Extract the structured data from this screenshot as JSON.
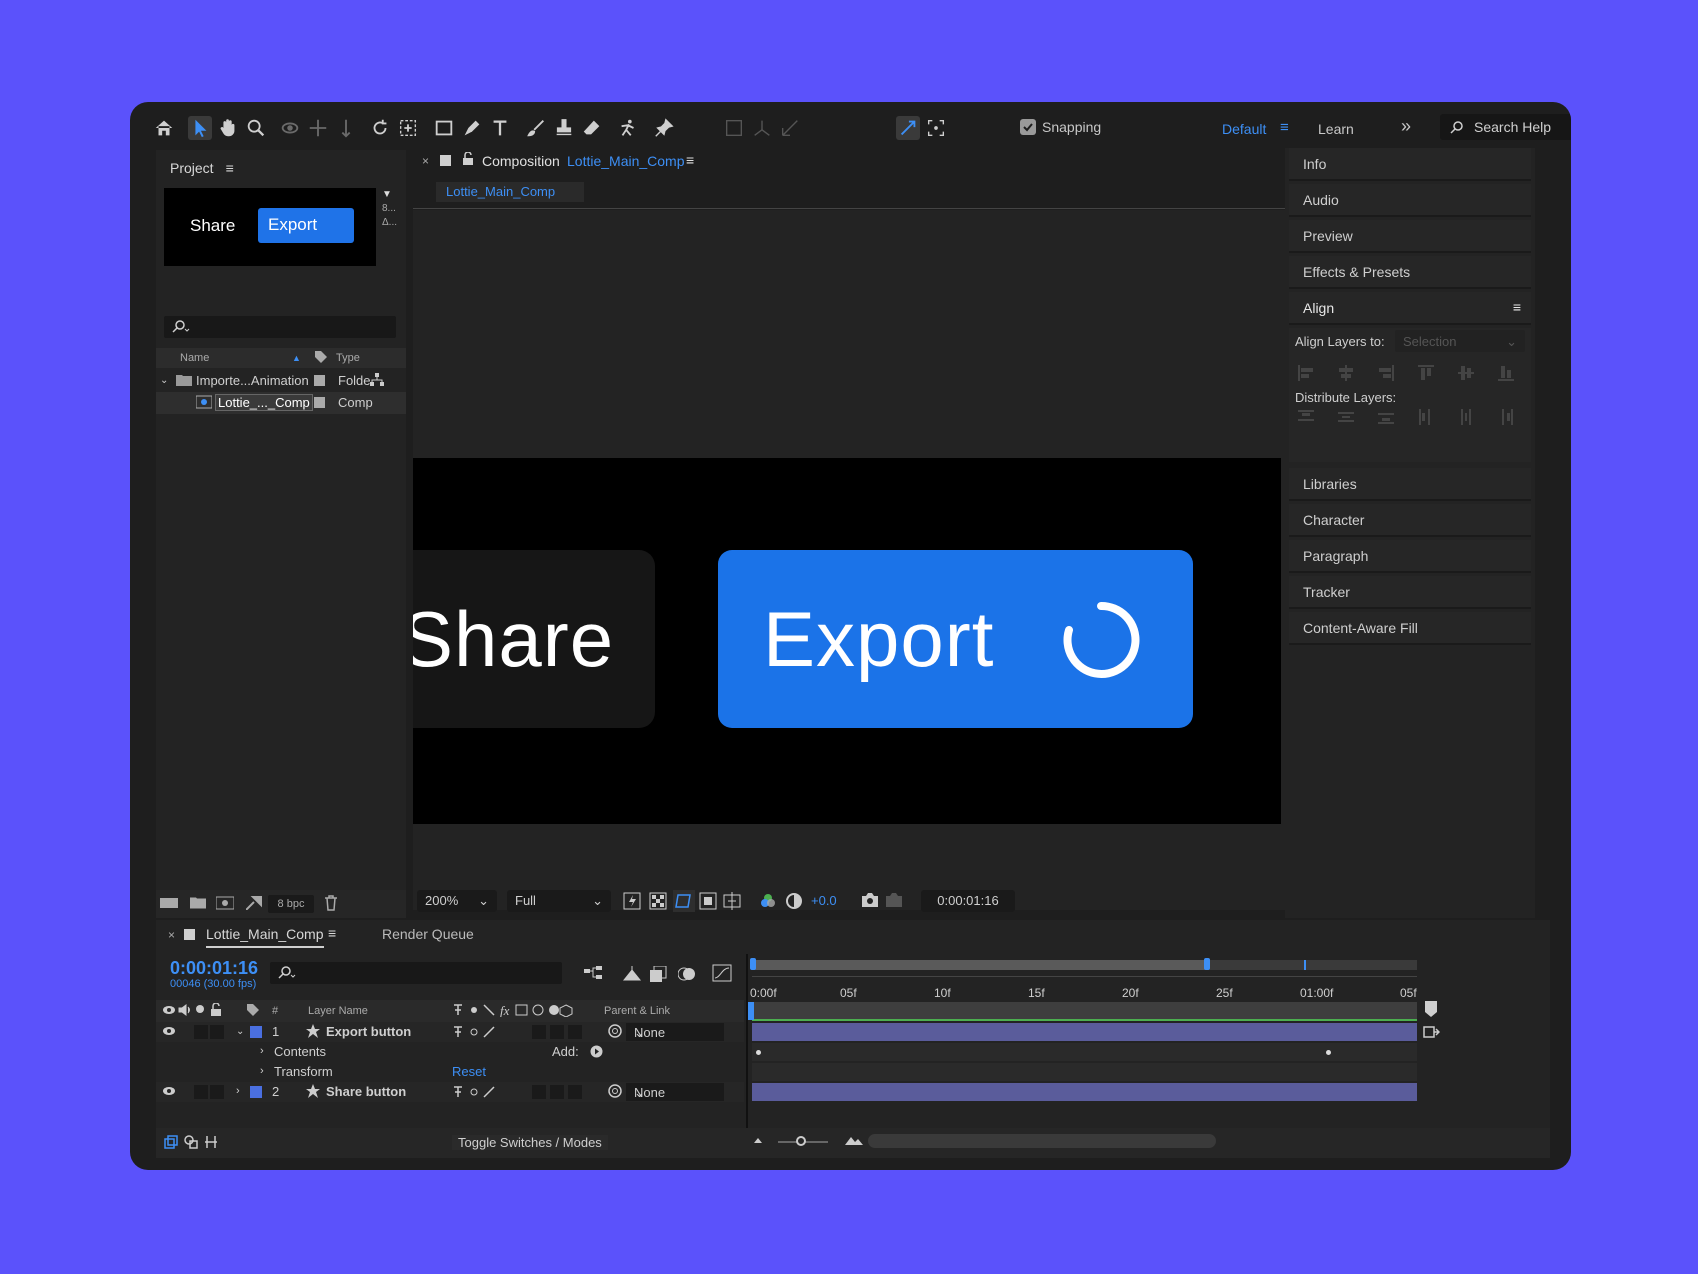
{
  "toolbar": {
    "snapping_label": "Snapping",
    "workspace_default": "Default",
    "workspace_learn": "Learn",
    "search_placeholder": "Search Help"
  },
  "project": {
    "title": "Project",
    "thumb_share": "Share",
    "thumb_export": "Export",
    "thumb_meta_1": "8...",
    "thumb_meta_2": "Δ...",
    "col_name": "Name",
    "col_type": "Type",
    "rows": [
      {
        "name": "Importe...Animation",
        "type": "Folde"
      },
      {
        "name": "Lottie_..._Comp",
        "type": "Comp"
      }
    ],
    "bpc": "8 bpc"
  },
  "composition": {
    "label": "Composition",
    "name": "Lottie_Main_Comp",
    "tab": "Lottie_Main_Comp",
    "canvas_share": "Share",
    "canvas_export": "Export",
    "zoom": "200%",
    "resolution": "Full",
    "exposure": "+0.0",
    "timecode": "0:00:01:16"
  },
  "right_panels": {
    "info": "Info",
    "audio": "Audio",
    "preview": "Preview",
    "effects": "Effects & Presets",
    "align": "Align",
    "align_to_label": "Align Layers to:",
    "align_to_value": "Selection",
    "distribute_label": "Distribute Layers:",
    "libraries": "Libraries",
    "character": "Character",
    "paragraph": "Paragraph",
    "tracker": "Tracker",
    "content_aware": "Content-Aware Fill"
  },
  "timeline": {
    "tab_comp": "Lottie_Main_Comp",
    "tab_render": "Render Queue",
    "timecode": "0:00:01:16",
    "frame_info": "00046 (30.00 fps)",
    "col_num": "#",
    "col_layer_name": "Layer Name",
    "col_parent": "Parent & Link",
    "ruler": [
      "0:00f",
      "05f",
      "10f",
      "15f",
      "20f",
      "25f",
      "01:00f",
      "05f"
    ],
    "layers": [
      {
        "num": "1",
        "name": "Export button",
        "parent": "None"
      },
      {
        "num": "2",
        "name": "Share button",
        "parent": "None"
      }
    ],
    "contents_label": "Contents",
    "add_label": "Add:",
    "transform_label": "Transform",
    "reset_label": "Reset",
    "toggle_label": "Toggle Switches / Modes"
  }
}
